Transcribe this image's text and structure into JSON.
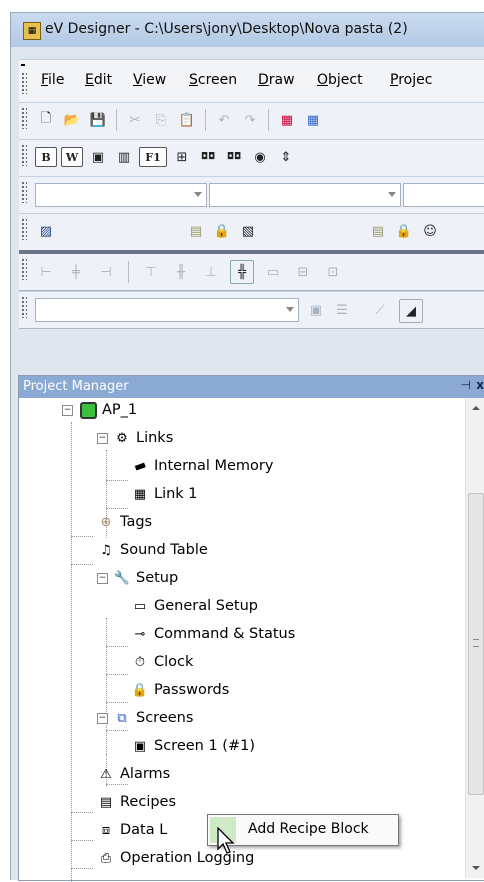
{
  "window": {
    "title": "eV Designer - C:\\Users\\jony\\Desktop\\Nova pasta (2)"
  },
  "menu": [
    {
      "label": "File",
      "underline": "F",
      "rest": "ile"
    },
    {
      "label": "Edit",
      "underline": "E",
      "rest": "dit"
    },
    {
      "label": "View",
      "underline": "V",
      "rest": "iew"
    },
    {
      "label": "Screen",
      "underline": "S",
      "rest": "creen"
    },
    {
      "label": "Draw",
      "underline": "D",
      "rest": "raw"
    },
    {
      "label": "Object",
      "underline": "O",
      "rest": "bject"
    },
    {
      "label": "Project",
      "underline": "P",
      "rest": "rojec"
    }
  ],
  "toolbar2": {
    "b_label": "B",
    "w_label": "W",
    "f1_label": "F1"
  },
  "project_manager": {
    "title": "Project Manager",
    "pin_glyph": "⊣",
    "close_glyph": "x",
    "tree": {
      "ap": "AP_1",
      "links": "Links",
      "internal_memory": "Internal Memory",
      "link1": "Link 1",
      "tags": "Tags",
      "sound_table": "Sound Table",
      "setup": "Setup",
      "general_setup": "General Setup",
      "command_status": "Command & Status",
      "clock": "Clock",
      "passwords": "Passwords",
      "screens": "Screens",
      "screen1": "Screen 1 (#1)",
      "alarms": "Alarms",
      "recipes": "Recipes",
      "data_logging": "Data L",
      "operation_logging": "Operation Logging"
    }
  },
  "context_menu": {
    "add_recipe_block": "Add Recipe Block"
  }
}
